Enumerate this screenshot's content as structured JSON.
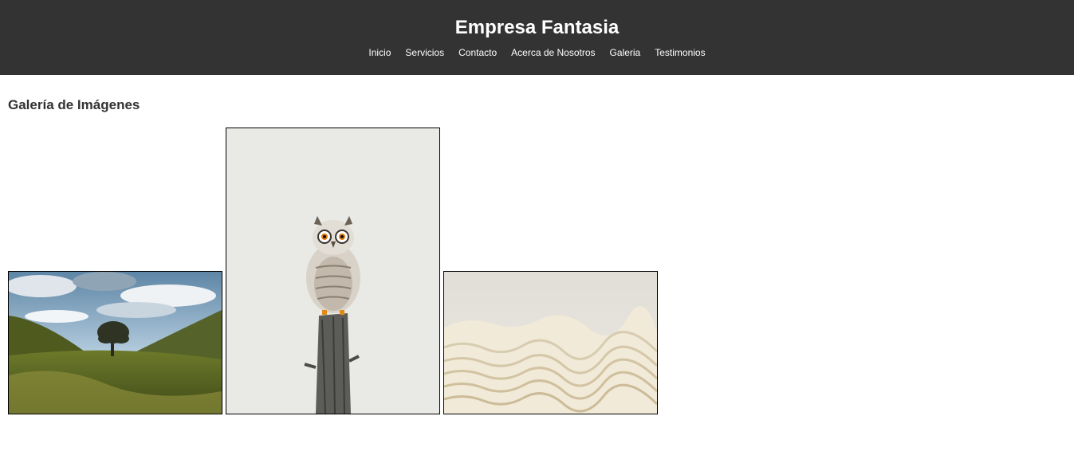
{
  "header": {
    "title": "Empresa Fantasia",
    "nav": [
      "Inicio",
      "Servicios",
      "Contacto",
      "Acerca de Nosotros",
      "Galeria",
      "Testimonios"
    ]
  },
  "gallery": {
    "title": "Galería de Imágenes",
    "images": [
      {
        "icon": "landscape-tree-photo"
      },
      {
        "icon": "owl-photo"
      },
      {
        "icon": "fabric-photo"
      }
    ]
  },
  "colors": {
    "header_bg": "#333333",
    "header_text": "#ffffff",
    "body_text": "#333333",
    "image_border": "#000000"
  }
}
